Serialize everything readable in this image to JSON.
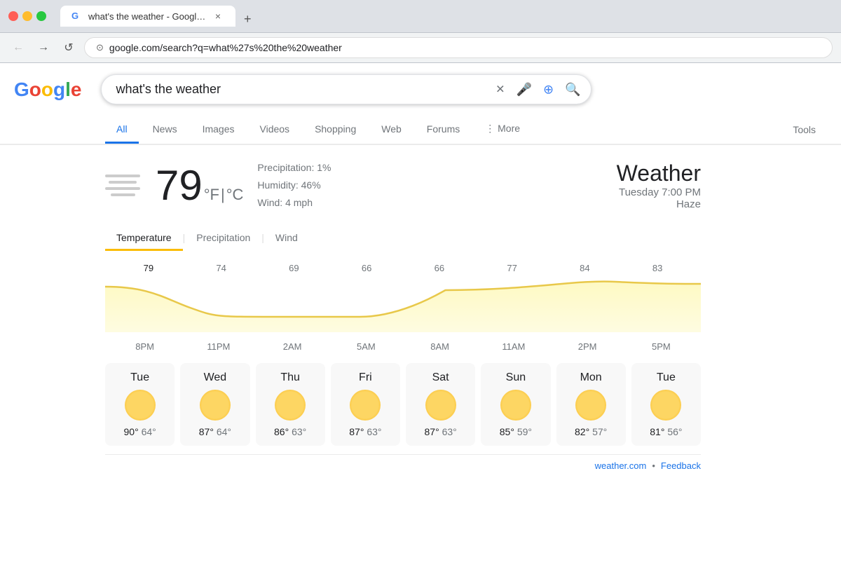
{
  "browser": {
    "tab_title": "what's the weather - Google S",
    "tab_favicon": "G",
    "url": "google.com/search?q=what%27s%20the%20weather",
    "nav": {
      "back": "←",
      "forward": "→",
      "reload": "↺"
    }
  },
  "google": {
    "logo": {
      "g1": "G",
      "o1": "o",
      "o2": "o",
      "g2": "g",
      "l": "l",
      "e": "e"
    },
    "search_query": "what's the weather",
    "search_placeholder": "what's the weather"
  },
  "search_tabs": [
    {
      "id": "all",
      "label": "All",
      "active": true
    },
    {
      "id": "news",
      "label": "News",
      "active": false
    },
    {
      "id": "images",
      "label": "Images",
      "active": false
    },
    {
      "id": "videos",
      "label": "Videos",
      "active": false
    },
    {
      "id": "shopping",
      "label": "Shopping",
      "active": false
    },
    {
      "id": "web",
      "label": "Web",
      "active": false
    },
    {
      "id": "forums",
      "label": "Forums",
      "active": false
    },
    {
      "id": "more",
      "label": "More",
      "active": false
    }
  ],
  "tools_label": "Tools",
  "weather": {
    "title": "Weather",
    "datetime": "Tuesday 7:00 PM",
    "condition": "Haze",
    "temperature": "79",
    "unit_f": "°F",
    "unit_c": "°C",
    "precipitation": "Precipitation: 1%",
    "humidity": "Humidity: 46%",
    "wind": "Wind: 4 mph",
    "view_tabs": [
      {
        "label": "Temperature",
        "active": true
      },
      {
        "label": "Precipitation",
        "active": false
      },
      {
        "label": "Wind",
        "active": false
      }
    ],
    "chart": {
      "temps": [
        "79",
        "74",
        "69",
        "66",
        "66",
        "77",
        "84",
        "83"
      ],
      "times": [
        "8PM",
        "11PM",
        "2AM",
        "5AM",
        "8AM",
        "11AM",
        "2PM",
        "5PM"
      ]
    },
    "daily": [
      {
        "day": "Tue",
        "high": "90°",
        "low": "64°"
      },
      {
        "day": "Wed",
        "high": "87°",
        "low": "64°"
      },
      {
        "day": "Thu",
        "high": "86°",
        "low": "63°"
      },
      {
        "day": "Fri",
        "high": "87°",
        "low": "63°"
      },
      {
        "day": "Sat",
        "high": "87°",
        "low": "63°"
      },
      {
        "day": "Sun",
        "high": "85°",
        "low": "59°"
      },
      {
        "day": "Mon",
        "high": "82°",
        "low": "57°"
      },
      {
        "day": "Tue",
        "high": "81°",
        "low": "56°"
      }
    ],
    "source": "weather.com",
    "feedback": "Feedback"
  }
}
